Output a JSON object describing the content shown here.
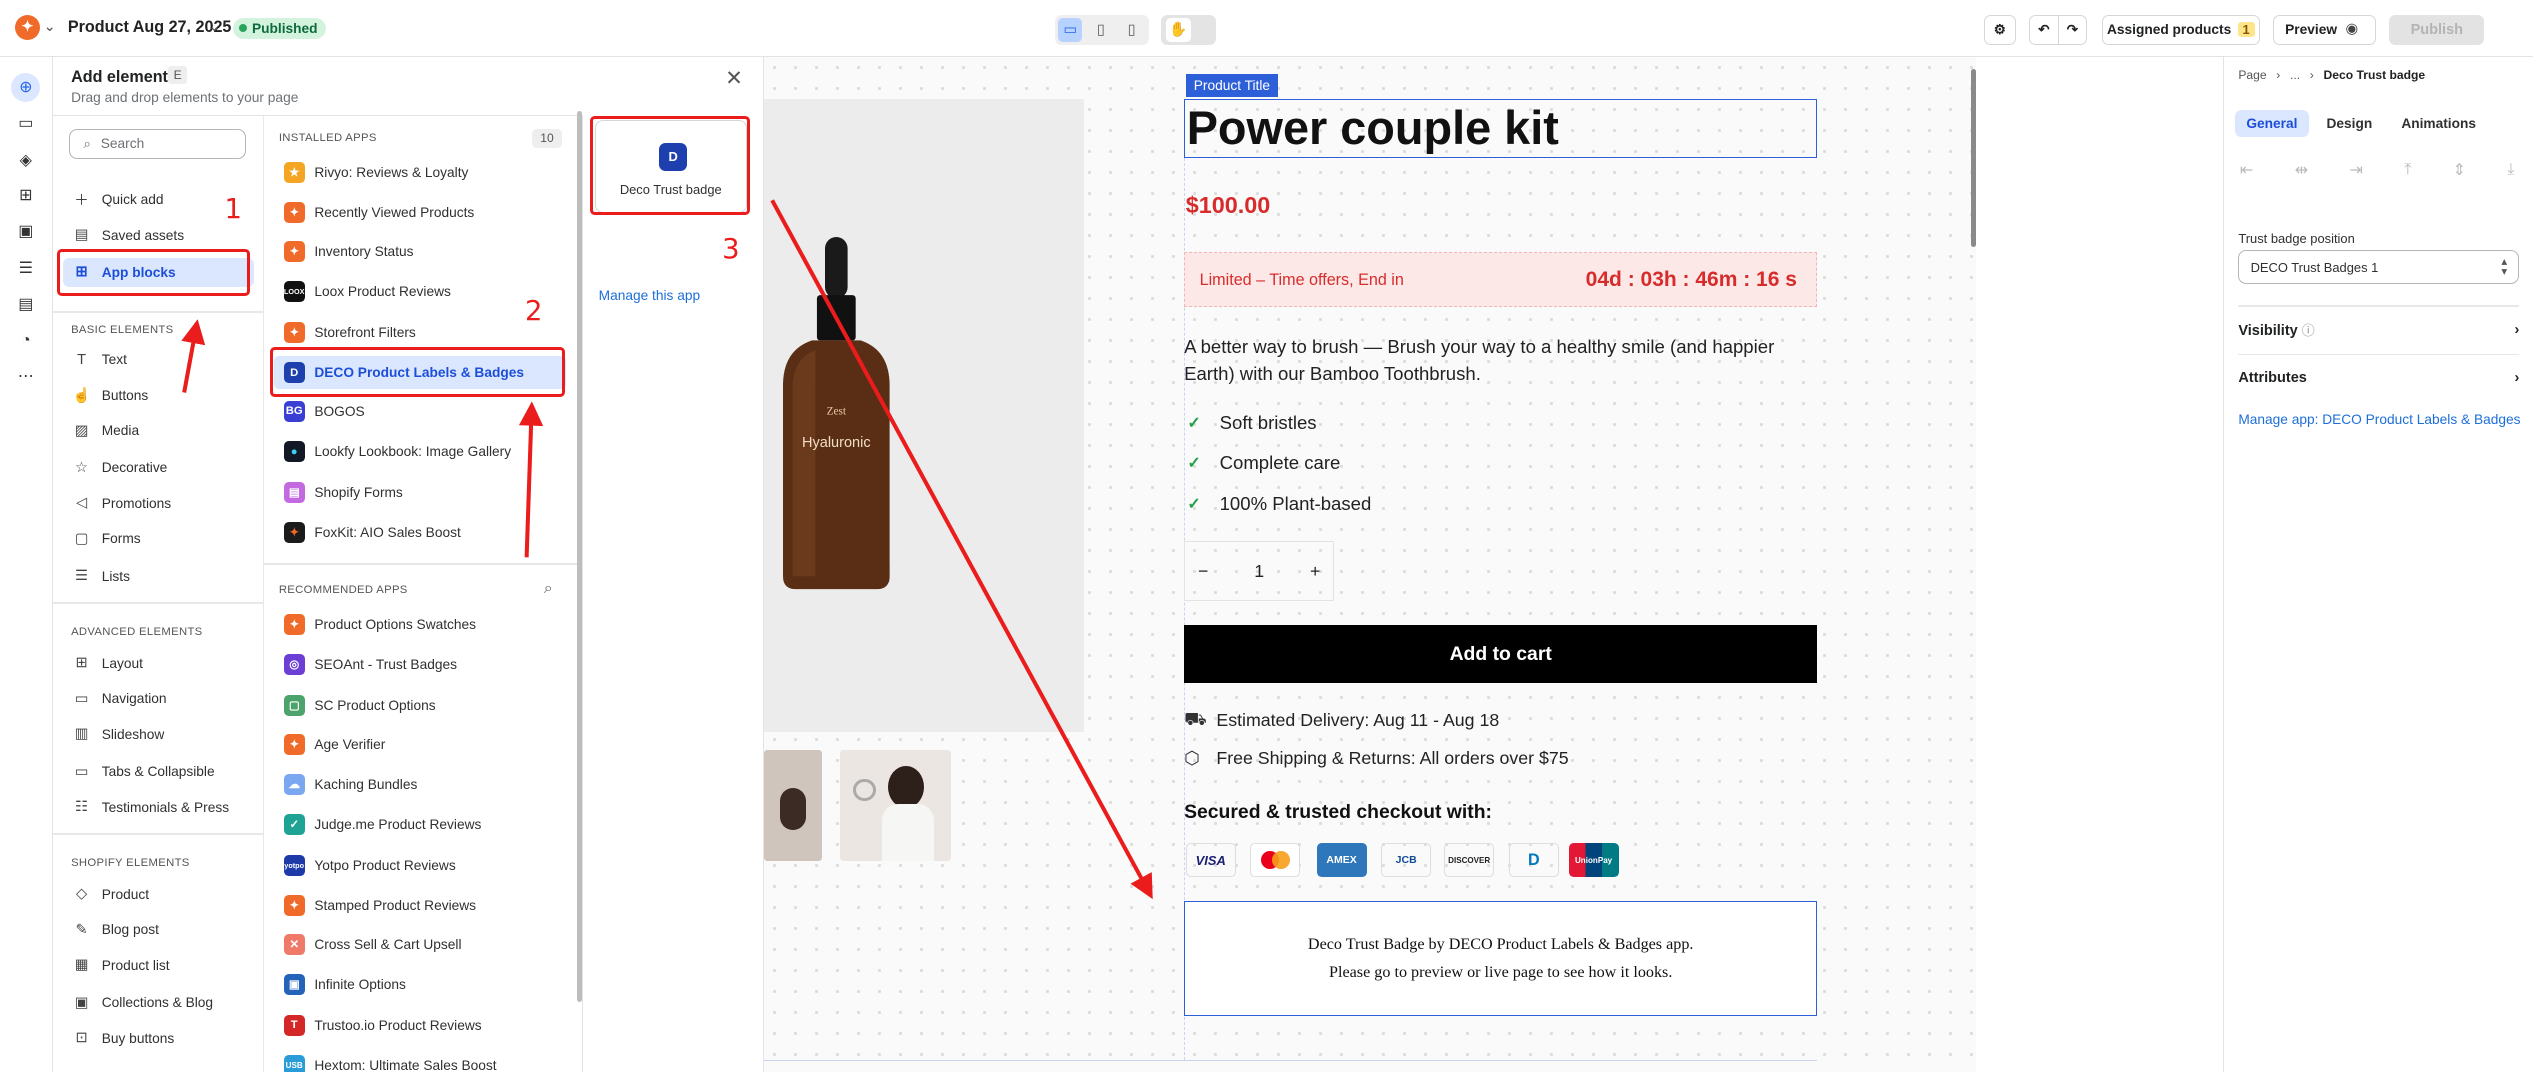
{
  "topbar": {
    "product_title": "Product Aug 27, 2025",
    "status": "Published",
    "assigned_products_label": "Assigned products",
    "assigned_products_count": "1",
    "preview_label": "Preview",
    "publish_label": "Publish"
  },
  "panel": {
    "title": "Add elements",
    "shortcut": "E",
    "subtitle": "Drag and drop elements to your page",
    "search_placeholder": "Search",
    "top_items": [
      "Quick add",
      "Saved assets",
      "App blocks"
    ],
    "basic_heading": "BASIC ELEMENTS",
    "basic_items": [
      "Text",
      "Buttons",
      "Media",
      "Decorative",
      "Promotions",
      "Forms",
      "Lists"
    ],
    "advanced_heading": "ADVANCED ELEMENTS",
    "advanced_items": [
      "Layout",
      "Navigation",
      "Slideshow",
      "Tabs & Collapsible",
      "Testimonials & Press"
    ],
    "shopify_heading": "SHOPIFY ELEMENTS",
    "shopify_items": [
      "Product",
      "Blog post",
      "Product list",
      "Collections & Blog",
      "Buy buttons"
    ],
    "installed_heading": "INSTALLED APPS",
    "installed_count": "10",
    "installed_apps": [
      "Rivyo: Reviews & Loyalty",
      "Recently Viewed Products",
      "Inventory Status",
      "Loox Product Reviews",
      "Storefront Filters",
      "DECO Product Labels & Badges",
      "BOGOS",
      "Lookfy Lookbook: Image Gallery",
      "Shopify Forms",
      "FoxKit: AIO Sales Boost"
    ],
    "recommended_heading": "RECOMMENDED APPS",
    "recommended_apps": [
      "Product Options Swatches",
      "SEOAnt - Trust Badges",
      "SC Product Options",
      "Age Verifier",
      "Kaching Bundles",
      "Judge.me Product Reviews",
      "Yotpo Product Reviews",
      "Stamped Product Reviews",
      "Cross Sell & Cart Upsell",
      "Infinite Options",
      "Trustoo.io Product Reviews",
      "Hextom: Ultimate Sales Boost"
    ],
    "block_card_label": "Deco Trust badge",
    "manage_app_link": "Manage this app"
  },
  "annotations": {
    "step1": "1",
    "step2": "2",
    "step3": "3"
  },
  "product": {
    "title_tag": "Product Title",
    "name": "Power couple kit",
    "price": "$100.00",
    "timer_label": "Limited – Time offers, End in",
    "timer_value": "04d : 03h : 46m : 16 s",
    "description": "A better way to brush — Brush your way to a healthy smile (and happier Earth) with our Bamboo Toothbrush.",
    "features": [
      "Soft bristles",
      "Complete care",
      "100% Plant-based"
    ],
    "quantity": "1",
    "add_to_cart": "Add to cart",
    "delivery": "Estimated Delivery: Aug 11 - Aug 18",
    "shipping": "Free Shipping & Returns: All orders over $75",
    "secure_heading": "Secured & trusted checkout with:",
    "payment_methods": [
      "VISA",
      "MC",
      "AMEX",
      "JCB",
      "DISCOVER",
      "D",
      "UnionPay"
    ],
    "trust_line1": "Deco Trust Badge by DECO Product Labels & Badges app.",
    "trust_line2": "Please go to preview or live page to see how it looks.",
    "bottle_brand": "Zest",
    "bottle_label": "Hyaluronic"
  },
  "inspector": {
    "breadcrumb": [
      "Page",
      "...",
      "Deco Trust badge"
    ],
    "tabs": [
      "General",
      "Design",
      "Animations"
    ],
    "position_label": "Trust badge position",
    "position_value": "DECO Trust Badges 1",
    "visibility_label": "Visibility",
    "attributes_label": "Attributes",
    "manage_link": "Manage app: DECO Product Labels & Badges"
  },
  "colors": {
    "accent": "#2563eb",
    "annotation_red": "#ea1c1c",
    "price_red": "#d82c2c"
  }
}
